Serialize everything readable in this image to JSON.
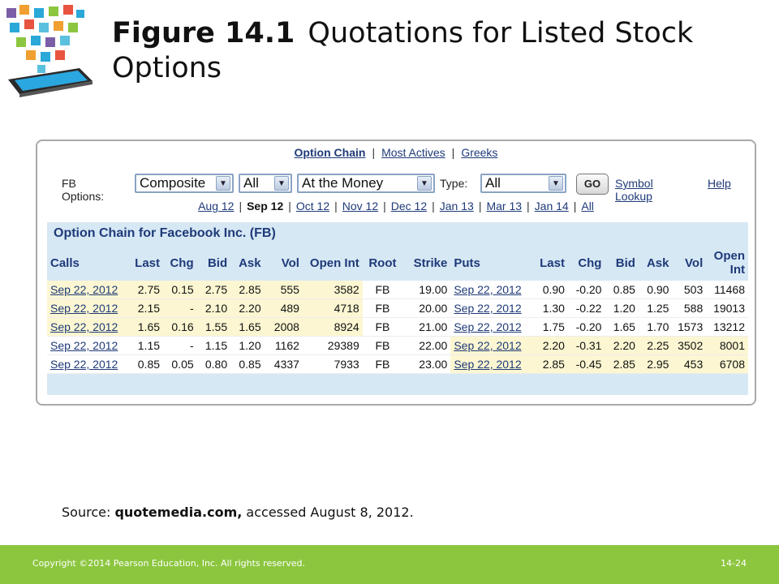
{
  "slide": {
    "figure_label": "Figure 14.1",
    "title": "Quotations for Listed Stock Options"
  },
  "topnav": {
    "items": [
      "Option Chain",
      "Most Actives",
      "Greeks"
    ],
    "separator": "|"
  },
  "options_bar": {
    "label": "FB Options:",
    "exchange_select": "Composite",
    "type1_select": "All",
    "moneyness_select": "At the Money",
    "type_label": "Type:",
    "type_select": "All",
    "go_label": "GO",
    "symbol_lookup": "Symbol Lookup",
    "help": "Help"
  },
  "months": {
    "items": [
      "Aug 12",
      "Sep 12",
      "Oct 12",
      "Nov 12",
      "Dec 12",
      "Jan 13",
      "Mar 13",
      "Jan 14",
      "All"
    ],
    "current": "Sep 12"
  },
  "chain": {
    "heading": "Option Chain for Facebook Inc. (FB)",
    "columns": [
      "Calls",
      "Last",
      "Chg",
      "Bid",
      "Ask",
      "Vol",
      "Open Int",
      "Root",
      "Strike",
      "Puts",
      "Last",
      "Chg",
      "Bid",
      "Ask",
      "Vol",
      "Open Int"
    ],
    "rows": [
      [
        "Sep 22, 2012",
        "2.75",
        "0.15",
        "2.75",
        "2.85",
        "555",
        "3582",
        "FB",
        "19.00",
        "Sep 22, 2012",
        "0.90",
        "-0.20",
        "0.85",
        "0.90",
        "503",
        "11468"
      ],
      [
        "Sep 22, 2012",
        "2.15",
        "-",
        "2.10",
        "2.20",
        "489",
        "4718",
        "FB",
        "20.00",
        "Sep 22, 2012",
        "1.30",
        "-0.22",
        "1.20",
        "1.25",
        "588",
        "19013"
      ],
      [
        "Sep 22, 2012",
        "1.65",
        "0.16",
        "1.55",
        "1.65",
        "2008",
        "8924",
        "FB",
        "21.00",
        "Sep 22, 2012",
        "1.75",
        "-0.20",
        "1.65",
        "1.70",
        "1573",
        "13212"
      ],
      [
        "Sep 22, 2012",
        "1.15",
        "-",
        "1.15",
        "1.20",
        "1162",
        "29389",
        "FB",
        "22.00",
        "Sep 22, 2012",
        "2.20",
        "-0.31",
        "2.20",
        "2.25",
        "3502",
        "8001"
      ],
      [
        "Sep 22, 2012",
        "0.85",
        "0.05",
        "0.80",
        "0.85",
        "4337",
        "7933",
        "FB",
        "23.00",
        "Sep 22, 2012",
        "2.85",
        "-0.45",
        "2.85",
        "2.95",
        "453",
        "6708"
      ]
    ],
    "call_in_money_rows": 3,
    "put_in_money_from_row": 4
  },
  "source": {
    "prefix": "Source: ",
    "site": "quotemedia.com,",
    "suffix": " accessed August 8, 2012."
  },
  "footer": {
    "copyright": "Copyright ©2014 Pearson Education, Inc. All rights reserved.",
    "page": "14-24"
  },
  "colors": {
    "footer_green": "#8cc63f",
    "table_header_blue": "#d7e8f5",
    "highlight_yellow": "#fcf7d2",
    "link_blue": "#1e3a78"
  }
}
